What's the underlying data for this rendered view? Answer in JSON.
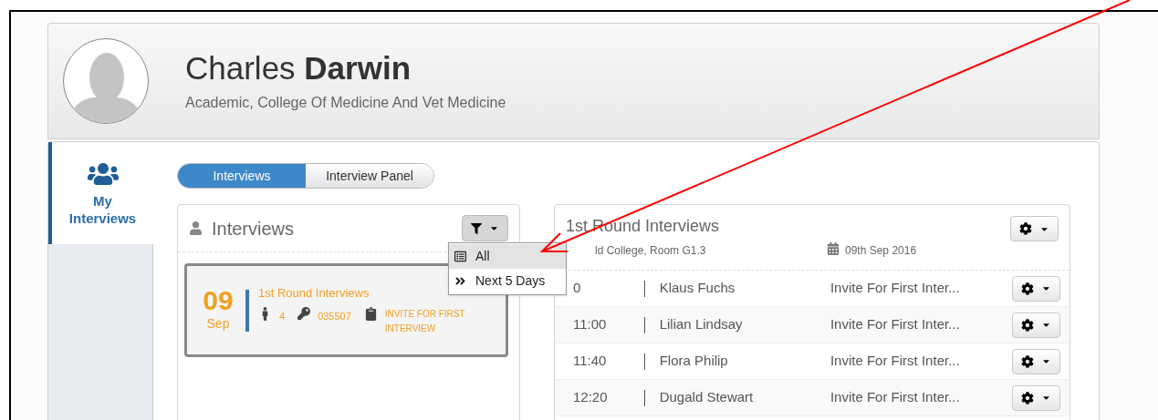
{
  "profile": {
    "name": "Charles **Darwin**",
    "subtitle": "Academic, College Of Medicine And Vet Medicine"
  },
  "sidebar": {
    "items": [
      {
        "label": "My Interviews",
        "selected": true
      }
    ]
  },
  "toggle": [
    {
      "label": "Interviews",
      "selected": true
    },
    {
      "label": "Interview Panel",
      "selected": false
    }
  ],
  "interviews_panel": {
    "title": "Interviews",
    "filter_menu": {
      "expanded": true,
      "items": [
        {
          "kind": "list",
          "label": "All",
          "selected": true
        },
        {
          "kind": "upcoming",
          "label": "Next 5 Days",
          "selected": false
        }
      ]
    },
    "cards": [
      {
        "day": "09",
        "month": "Sep",
        "title": "1st Round Interviews",
        "count": "4",
        "code": "035507",
        "status": "INVITE FOR FIRST INTERVIEW"
      }
    ]
  },
  "round_panel": {
    "title": "1st Round Interviews",
    "location": "ld College, Room G1.3",
    "date": "09th Sep 2016",
    "rows": [
      {
        "time": "0",
        "name": "Klaus Fuchs",
        "status": "Invite For First Inter..."
      },
      {
        "time": "11:00",
        "name": "Lilian Lindsay",
        "status": "Invite For First Inter..."
      },
      {
        "time": "11:40",
        "name": "Flora Philip",
        "status": "Invite For First Inter..."
      },
      {
        "time": "12:20",
        "name": "Dugald Stewart",
        "status": "Invite For First Inter..."
      }
    ]
  }
}
